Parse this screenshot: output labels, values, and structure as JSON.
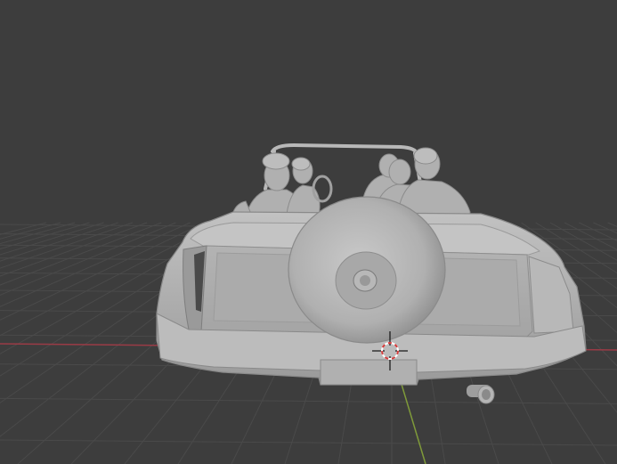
{
  "app": {
    "view": "3D Viewport",
    "shading": "solid"
  },
  "scene": {
    "model": "convertible-car-with-passengers",
    "background_color": "#3d3d3d",
    "grid_color": "#4a4a4a",
    "x_axis_color": "#9a3b46",
    "y_axis_color": "#7f9a3a",
    "mesh_color": "#b4b4b4"
  },
  "icons": {
    "cursor": "3d-cursor-icon"
  }
}
